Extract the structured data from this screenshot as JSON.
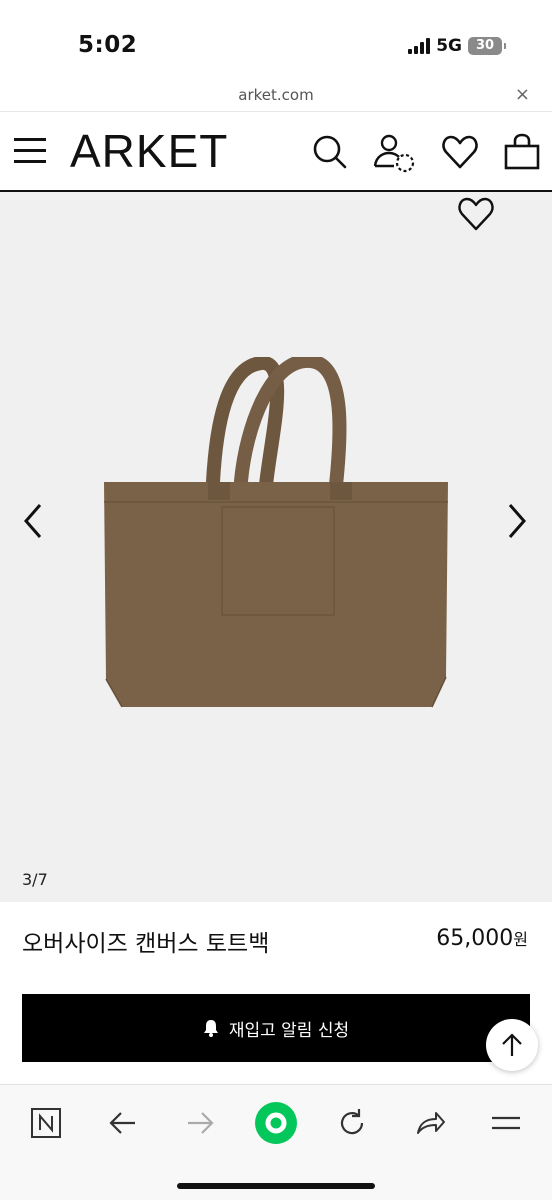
{
  "status_bar": {
    "time": "5:02",
    "network": "5G",
    "battery": "30"
  },
  "browser": {
    "url": "arket.com",
    "close_label": "×"
  },
  "header": {
    "logo": "ARKET"
  },
  "gallery": {
    "counter": "3/7"
  },
  "product": {
    "name": "오버사이즈 캔버스 토트백",
    "price": "65,000",
    "currency": "원"
  },
  "notify_button": {
    "label": "재입고 알림 신청"
  },
  "colors": {
    "bag": "#7a6248",
    "media_bg": "#f0f0f0",
    "button_bg": "#000000",
    "naver_green": "#03c75a"
  },
  "toolbar": {
    "items": [
      "naver-icon",
      "back-icon",
      "forward-icon",
      "green-dot-icon",
      "refresh-icon",
      "share-icon",
      "menu-icon"
    ]
  }
}
